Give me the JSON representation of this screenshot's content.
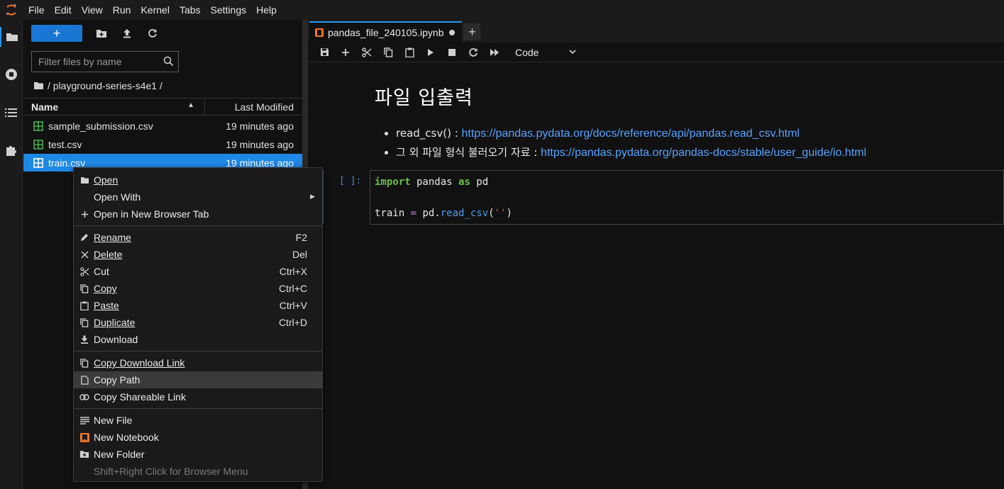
{
  "menubar": {
    "items": [
      "File",
      "Edit",
      "View",
      "Run",
      "Kernel",
      "Tabs",
      "Settings",
      "Help"
    ]
  },
  "activity": {
    "icons": [
      "folder-icon",
      "running-icon",
      "toc-icon",
      "extension-icon"
    ]
  },
  "filebrowser": {
    "new_label": "+",
    "filter_placeholder": "Filter files by name",
    "breadcrumb": "/ playground-series-s4e1 /",
    "header": {
      "name": "Name",
      "modified": "Last Modified"
    },
    "files": [
      {
        "name": "sample_submission.csv",
        "modified": "19 minutes ago"
      },
      {
        "name": "test.csv",
        "modified": "19 minutes ago"
      },
      {
        "name": "train.csv",
        "modified": "19 minutes ago"
      }
    ]
  },
  "notebook": {
    "tab_label": "pandas_file_240105.ipynb",
    "add_tab": "+",
    "cell_type": "Code",
    "markdown": {
      "heading": "파일 입출력",
      "bullets": [
        {
          "prefix": "read_csv() : ",
          "link": "https://pandas.pydata.org/docs/reference/api/pandas.read_csv.html"
        },
        {
          "prefix": "그 외 파일 형식 불러오기 자료 : ",
          "link": "https://pandas.pydata.org/pandas-docs/stable/user_guide/io.html"
        }
      ]
    },
    "code_cell": {
      "prompt": "[ ]:",
      "line1": {
        "kw1": "import",
        "mod": " pandas ",
        "kw2": "as",
        "alias": " pd"
      },
      "line3": {
        "var": "train ",
        "eq": "=",
        "obj": " pd.",
        "fn": "read_csv",
        "open": "(",
        "str": "''",
        "close": ")"
      }
    }
  },
  "context_menu": {
    "items": [
      {
        "label": "Open",
        "shortcut": ""
      },
      {
        "label": "Open With",
        "shortcut": ""
      },
      {
        "label": "Open in New Browser Tab",
        "shortcut": ""
      },
      {
        "label": "Rename",
        "shortcut": "F2"
      },
      {
        "label": "Delete",
        "shortcut": "Del"
      },
      {
        "label": "Cut",
        "shortcut": "Ctrl+X"
      },
      {
        "label": "Copy",
        "shortcut": "Ctrl+C"
      },
      {
        "label": "Paste",
        "shortcut": "Ctrl+V"
      },
      {
        "label": "Duplicate",
        "shortcut": "Ctrl+D"
      },
      {
        "label": "Download",
        "shortcut": ""
      },
      {
        "label": "Copy Download Link",
        "shortcut": ""
      },
      {
        "label": "Copy Path",
        "shortcut": ""
      },
      {
        "label": "Copy Shareable Link",
        "shortcut": ""
      },
      {
        "label": "New File",
        "shortcut": ""
      },
      {
        "label": "New Notebook",
        "shortcut": ""
      },
      {
        "label": "New Folder",
        "shortcut": ""
      },
      {
        "label": "Shift+Right Click for Browser Menu",
        "shortcut": ""
      }
    ]
  },
  "colors": {
    "accent": "#1e88e5",
    "link": "#57a3ff",
    "notebook_orange": "#f37726",
    "csv_green": "#4caf50"
  }
}
